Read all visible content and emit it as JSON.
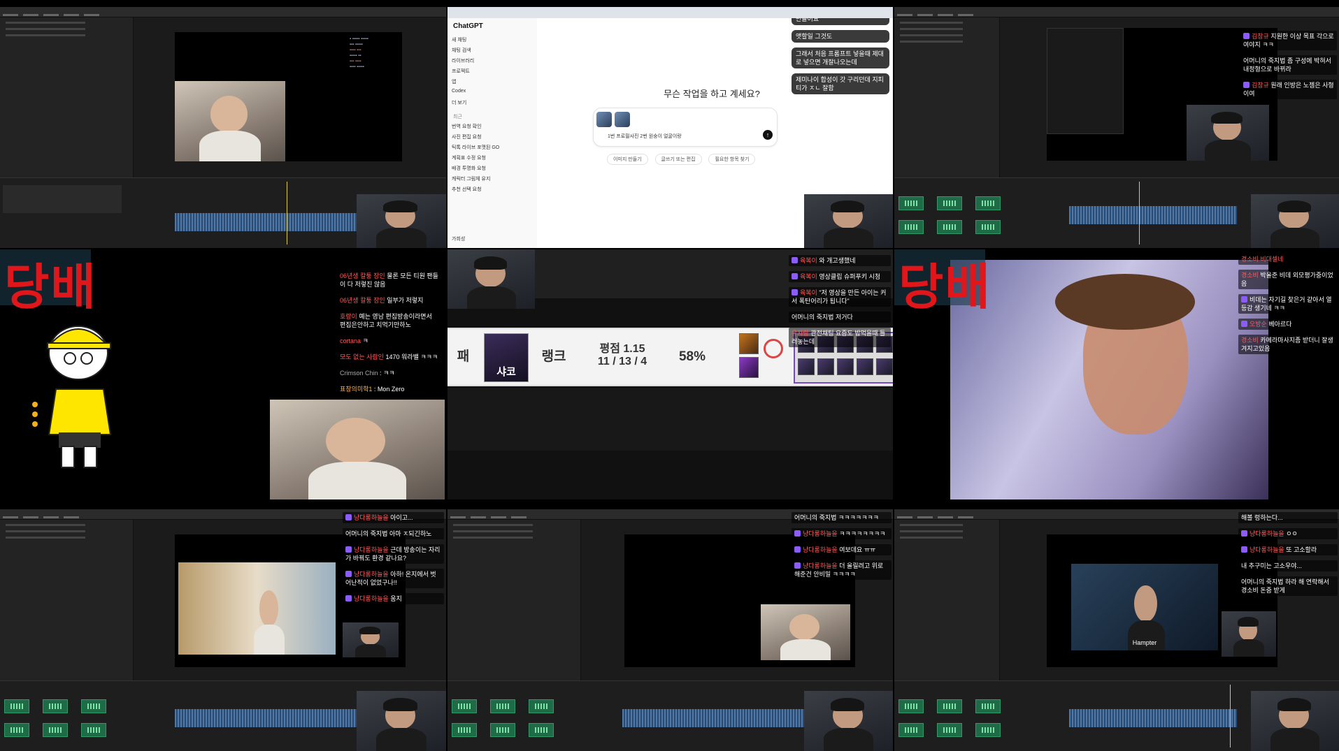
{
  "panel1": {
    "chat": "",
    "cam_label": ""
  },
  "panel2": {
    "app_title": "ChatGPT",
    "nav": [
      "새 채팅",
      "채팅 검색",
      "라이브러리",
      "프로젝트",
      "앱",
      "Codex",
      "더 보기"
    ],
    "recent_label": "최근",
    "history": [
      "번역 요청 확인",
      "사진 편집 요청",
      "틱톡 라이브 포맷된 GO",
      "계획표 수정 요청",
      "배경 투명화 요청",
      "캐릭터 그림체 유지",
      "추천 선택 요청"
    ],
    "user_name": "가희성",
    "question": "무슨 작업을 하고 계세요?",
    "input_text": "1번 프로필사진 2번 원숭이 얼굴이랑",
    "chips": [
      "이미지 만들기",
      "글쓰기 또는 편집",
      "필요한 항목 찾기"
    ],
    "send_icon": "arrow-up-icon",
    "chat": [
      {
        "user": "",
        "text": "만들어요"
      },
      {
        "user": "",
        "text": "앳할일 그것도"
      },
      {
        "user": "",
        "text": "그래서 처음 프롬프트 넣을때 제대로 넣으면 개잘나오는데"
      },
      {
        "user": "",
        "text": "제미나이 합성이 갓 구리던데 지피티가 ㅈㄴ 잘함"
      }
    ]
  },
  "panel3": {
    "chat": [
      {
        "user": "김창규",
        "text": "지원한 이상 목표 각으로 여야지 ㅋㅋ"
      },
      {
        "user": "",
        "text": "어머니의 죽지법 좀 구성에 박혀서 내정형으로 바뀌라"
      },
      {
        "user": "김창규",
        "text": "원래 인방은 노젬은 사형이여"
      }
    ]
  },
  "panel4": {
    "overlay_text": "당배",
    "chat": [
      {
        "user": "06년생 칼퉁 장인",
        "text": "물론 모든 티원 팬들이 다 저렇진 않음"
      },
      {
        "user": "06년생 칼퉁 장인",
        "text": "일부가 저렇지"
      },
      {
        "user": "호랑이",
        "text": "예는 영남 편집방송이라면서 편집은안하고 치먹기만하노"
      },
      {
        "user": "cortana",
        "text": "ㅋ"
      },
      {
        "user": "모도 없는 사람인",
        "text": "1470 워라밸 ㅋㅋㅋ"
      },
      {
        "user": "Crimson Chin",
        "text": "ㅋㅋ"
      },
      {
        "user": "표창의미학1",
        "text": "Mon Zero"
      }
    ]
  },
  "panel5": {
    "row_prefix": "패",
    "champion": "샤코",
    "rank_label": "랭크",
    "score_label": "평점 1.15",
    "kda": "11 / 13 / 4",
    "winrate": "58%",
    "chat": [
      {
        "user": "육복이",
        "text": "와 개고생했네"
      },
      {
        "user": "육복이",
        "text": "영상클립 슈퍼푸키 시청"
      },
      {
        "user": "육복이",
        "text": "\"저 영상을 만든 아이는 커서 폭탄어리가 됩니다\""
      },
      {
        "user": "",
        "text": "어머니의 죽지법 저거다"
      },
      {
        "user": "유자랑",
        "text": "관전채팅 요즘도 밥먹을때 틀러놓는데"
      }
    ]
  },
  "panel6": {
    "overlay_text": "당배",
    "chat": [
      {
        "user": "",
        "text": "경소비 비대셀네"
      },
      {
        "user": "경소비",
        "text": "박올준 비데 외모평가중이었음"
      },
      {
        "user": "",
        "text": "비데는 자기길 찾은거 같아서 열등감 생기네 ㅋㅋ"
      },
      {
        "user": "오방순",
        "text": "베아르다"
      },
      {
        "user": "경소비",
        "text": "카메라마사지좀 받더니 잘생겨지고있음"
      }
    ]
  },
  "panel7": {
    "chat": [
      {
        "user": "냥다롱하늘을",
        "text": "아이고..."
      },
      {
        "user": "",
        "text": "어머니의 죽지법 아마 ㅈ되긴하노"
      },
      {
        "user": "냥다롱하늘을",
        "text": "근데 방송이는 자리가 바꿔도 환경 같나요?"
      },
      {
        "user": "냥다롱하늘을",
        "text": "아하! 온지에서 벗어난적이 없었구나!!"
      },
      {
        "user": "냥다롱하늘을",
        "text": "움지"
      }
    ]
  },
  "panel8": {
    "chat": [
      {
        "user": "",
        "text": "어머니의 죽지법 ㅋㅋㅋㅋㅋㅋㅋ"
      },
      {
        "user": "냥다롱하늘을",
        "text": "ㅋㅋㅋㅋㅋㅋㅋㅋ"
      },
      {
        "user": "냥다롱하늘을",
        "text": "여보데요 ㅠㅠ"
      },
      {
        "user": "냥다롱하늘을",
        "text": "더 올릴려고 위로 해준건 안비밀 ㅋㅋㅋㅋ"
      }
    ]
  },
  "panel9": {
    "cam_caption": "Hampter",
    "chat": [
      {
        "user": "",
        "text": "해볼 렁하는다..."
      },
      {
        "user": "냥다롱하늘을",
        "text": "ㅇㅇ"
      },
      {
        "user": "냥다롱하늘을",
        "text": "또 고소할라"
      },
      {
        "user": "",
        "text": "내 추구미는 고소우야..."
      },
      {
        "user": "",
        "text": "어머니의 죽지법 하라 해 연락해서 경소비 돈줌 받게"
      }
    ]
  },
  "colors": {
    "accent_red": "#e0161a",
    "heart_purple": "#8b5cf6",
    "waveform_blue": "#4e78a8",
    "audio_green": "#1f6b48"
  }
}
